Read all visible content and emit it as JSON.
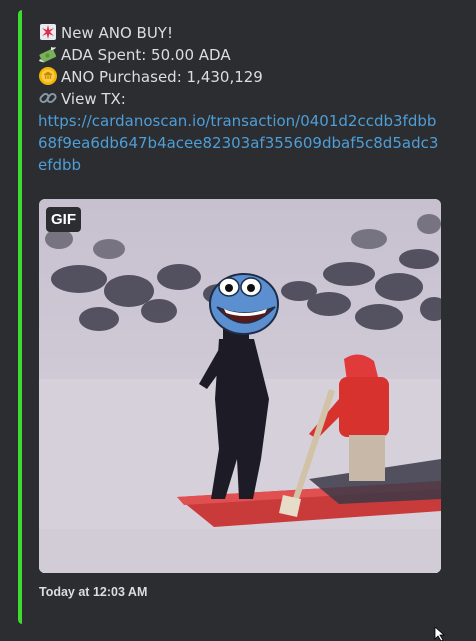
{
  "message": {
    "line1": {
      "icon": "rotating-light-icon",
      "text": "New ANO BUY!"
    },
    "line2": {
      "icon": "money-with-wings-icon",
      "text": "ADA Spent: 50.00 ADA"
    },
    "line3": {
      "icon": "coin-icon",
      "text": "ANO Purchased: 1,430,129"
    },
    "line4": {
      "icon": "link-icon",
      "text": "View TX:"
    },
    "tx_link": "https://cardanoscan.io/transaction/0401d2ccdb3fdbb68f9ea6db647b4acee82303af355609dbaf5c8d5adc3efdbb"
  },
  "gif": {
    "badge": "GIF",
    "icon": "pepe-rowing-boat-animation"
  },
  "footer": {
    "timestamp": "Today at 12:03 AM"
  },
  "colors": {
    "accent_bar": "#3ddc2f",
    "link": "#4e9ed8",
    "background": "#2b2d31"
  }
}
